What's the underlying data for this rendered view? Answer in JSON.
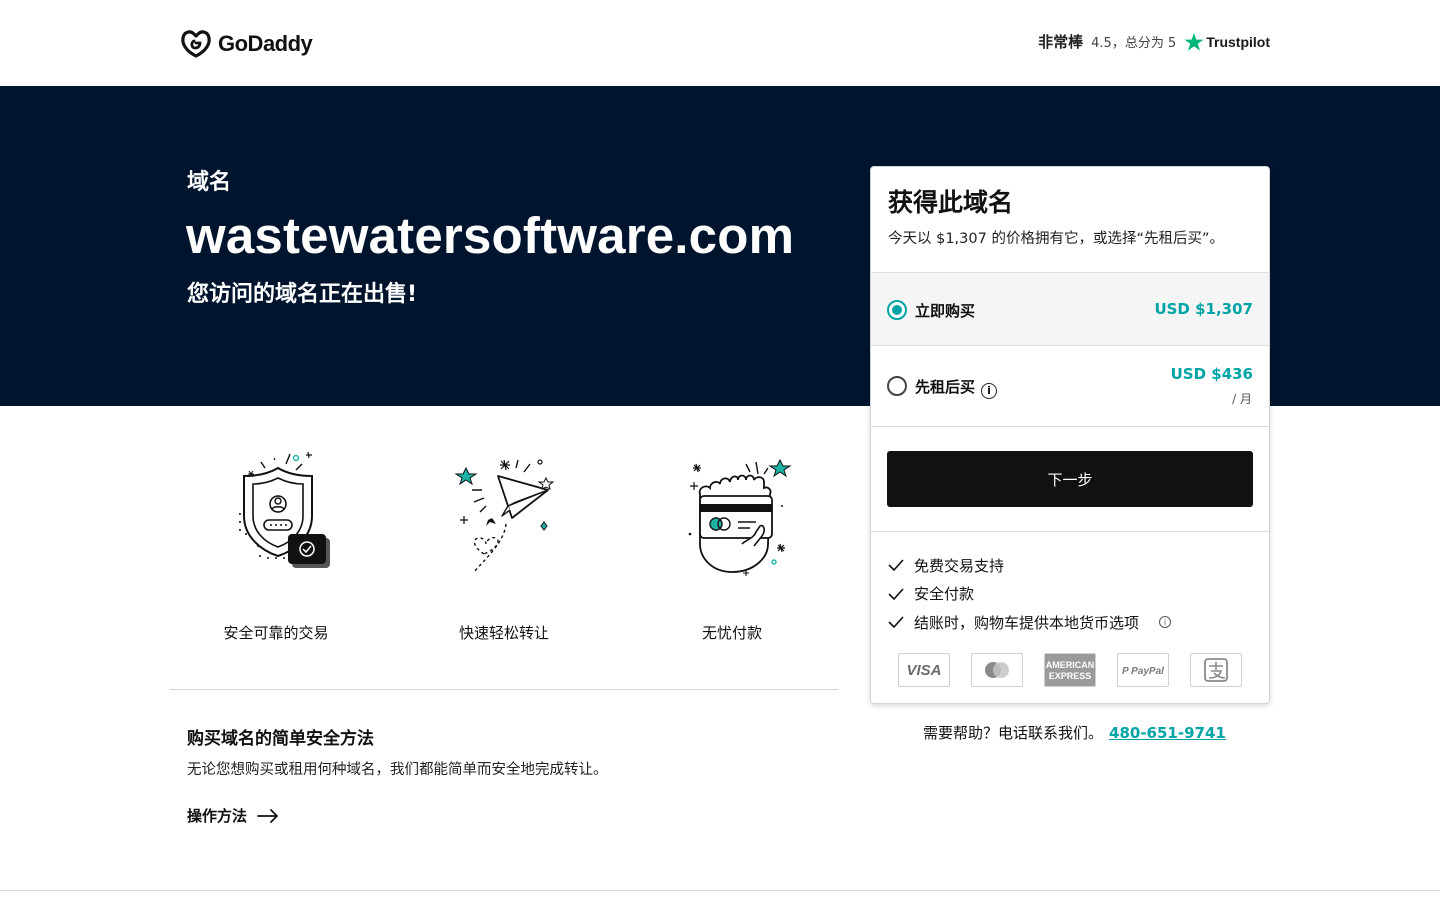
{
  "header": {
    "logo_text": "GoDaddy",
    "rating_label": "非常棒",
    "rating_score": "4.5，总分为 5",
    "trustpilot": "Trustpilot"
  },
  "hero": {
    "kicker": "域名",
    "domain": "wastewatersoftware.com",
    "subtitle": "您访问的域名正在出售!"
  },
  "features": [
    {
      "icon": "shield-user-icon",
      "caption": "安全可靠的交易"
    },
    {
      "icon": "paper-plane-icon",
      "caption": "快速轻松转让"
    },
    {
      "icon": "card-hand-icon",
      "caption": "无忧付款"
    }
  ],
  "howto": {
    "title": "购买域名的简单安全方法",
    "description": "无论您想购买或租用何种域名，我们都能简单而安全地完成转让。",
    "link": "操作方法"
  },
  "card": {
    "title": "获得此域名",
    "subtitle": "今天以 $1,307 的价格拥有它，或选择“先租后买”。",
    "options": [
      {
        "label": "立即购买",
        "price": "USD $1,307",
        "selected": true
      },
      {
        "label": "先租后买",
        "price": "USD $436",
        "period": "/ 月",
        "selected": false
      }
    ],
    "next_label": "下一步",
    "benefits": [
      "免费交易支持",
      "安全付款",
      "结账时，购物车提供本地货币选项"
    ],
    "payment_methods": [
      "visa-icon",
      "mastercard-icon",
      "amex-icon",
      "paypal-icon",
      "alipay-icon"
    ]
  },
  "help": {
    "text": "需要帮助？电话联系我们。",
    "phone": "480-651-9741"
  },
  "colors": {
    "hero_bg": "#00142e",
    "accent": "#00a4a6",
    "button": "#111111"
  }
}
